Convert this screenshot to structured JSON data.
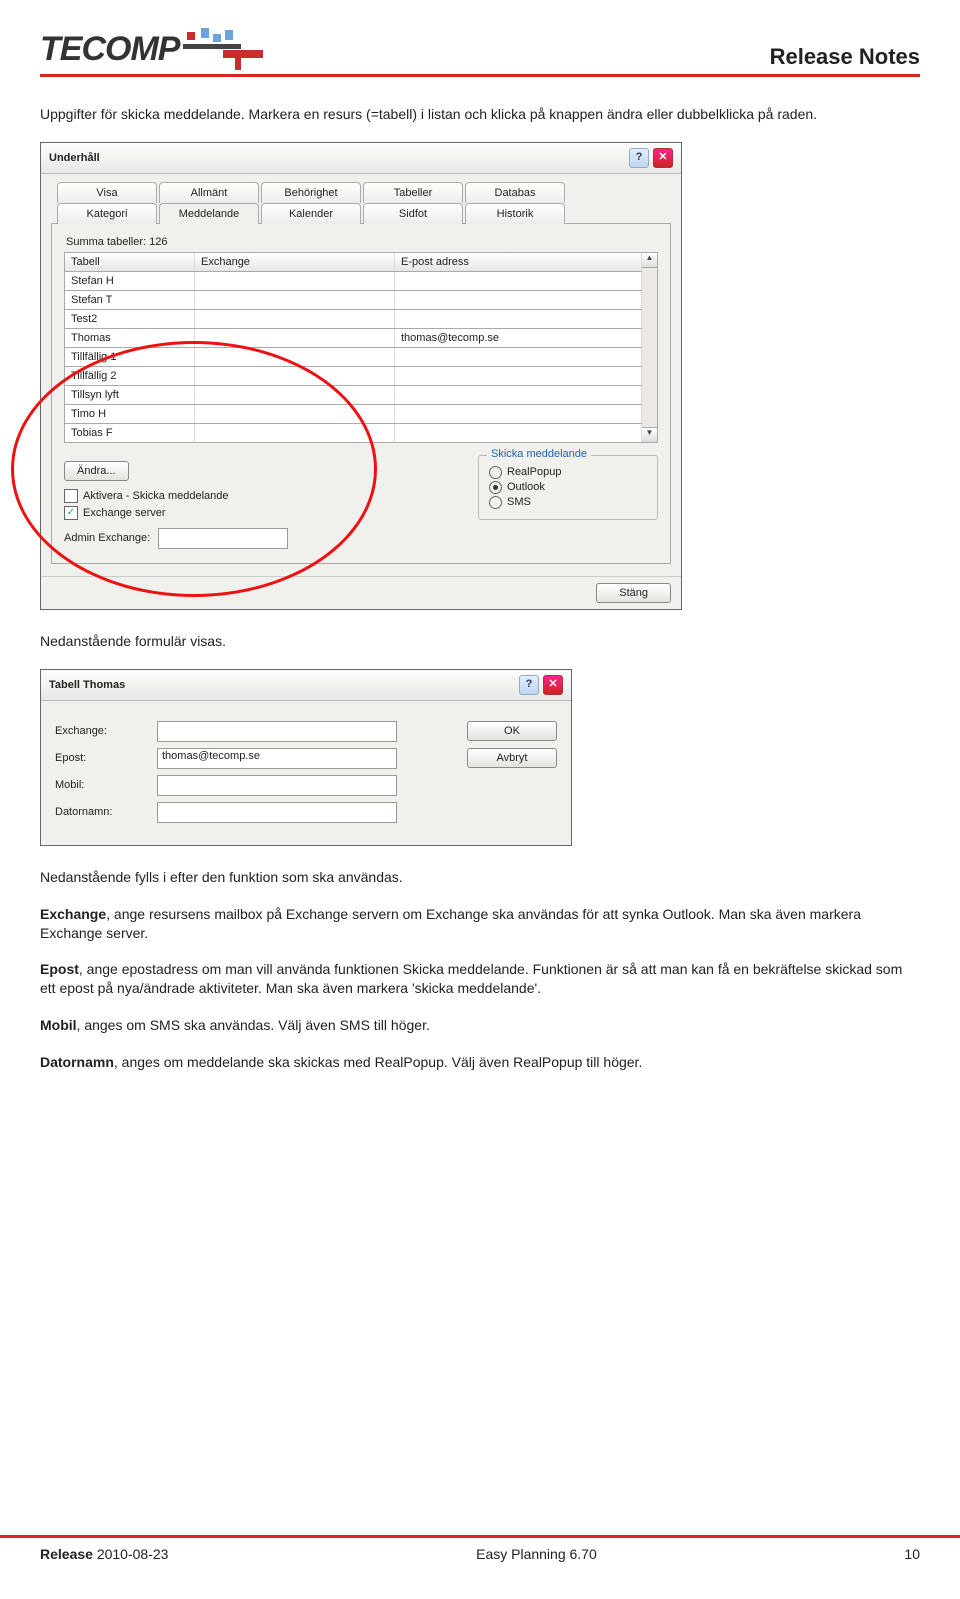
{
  "header": {
    "logo_text": "TECOMP",
    "title": "Release Notes"
  },
  "intro": "Uppgifter för skicka meddelande. Markera en resurs (=tabell) i listan och klicka på knappen ändra eller dubbelklicka på raden.",
  "dlg1": {
    "title": "Underhåll",
    "tabs_row1": [
      "Visa",
      "Allmänt",
      "Behörighet",
      "Tabeller",
      "Databas"
    ],
    "tabs_row2": [
      "Kategori",
      "Meddelande",
      "Kalender",
      "Sidfot",
      "Historik"
    ],
    "summa": "Summa tabeller: 126",
    "th": [
      "Tabell",
      "Exchange",
      "E-post adress"
    ],
    "rows": [
      {
        "c1": "Stefan H",
        "c2": "",
        "c3": ""
      },
      {
        "c1": "Stefan T",
        "c2": "",
        "c3": ""
      },
      {
        "c1": "Test2",
        "c2": "",
        "c3": ""
      },
      {
        "c1": "Thomas",
        "c2": "",
        "c3": "thomas@tecomp.se"
      },
      {
        "c1": "Tillfällig 1",
        "c2": "",
        "c3": ""
      },
      {
        "c1": "Tillfällig 2",
        "c2": "",
        "c3": ""
      },
      {
        "c1": "Tillsyn lyft",
        "c2": "",
        "c3": ""
      },
      {
        "c1": "Timo H",
        "c2": "",
        "c3": ""
      },
      {
        "c1": "Tobias F",
        "c2": "",
        "c3": ""
      }
    ],
    "edit_btn": "Ändra...",
    "chk1": "Aktivera - Skicka meddelande",
    "chk2": "Exchange server",
    "admin_label": "Admin Exchange:",
    "group_title": "Skicka meddelande",
    "r1": "RealPopup",
    "r2": "Outlook",
    "r3": "SMS",
    "close_btn": "Stäng"
  },
  "mid_text": "Nedanstående formulär visas.",
  "dlg2": {
    "title": "Tabell Thomas",
    "f1": "Exchange:",
    "f2": "Epost:",
    "f3": "Mobil:",
    "f4": "Datornamn:",
    "v2": "thomas@tecomp.se",
    "ok": "OK",
    "cancel": "Avbryt"
  },
  "p1": "Nedanstående fylls i efter den funktion som ska användas.",
  "p2a": "Exchange",
  "p2b": ", ange resursens mailbox på Exchange servern om Exchange ska användas för att synka Outlook. Man ska även markera Exchange server.",
  "p3a": "Epost",
  "p3b": ", ange epostadress om man vill använda funktionen Skicka meddelande. Funktionen är så att man kan få en bekräftelse skickad som ett epost på nya/ändrade aktiviteter. Man ska även markera 'skicka meddelande'.",
  "p4a": "Mobil",
  "p4b": ", anges om SMS ska användas. Välj även SMS till höger.",
  "p5a": "Datornamn",
  "p5b": ", anges om meddelande ska skickas med RealPopup. Välj även RealPopup till höger.",
  "footer": {
    "left_b": "Release ",
    "left": "2010-08-23",
    "mid": "Easy Planning 6.70",
    "right": "10"
  }
}
